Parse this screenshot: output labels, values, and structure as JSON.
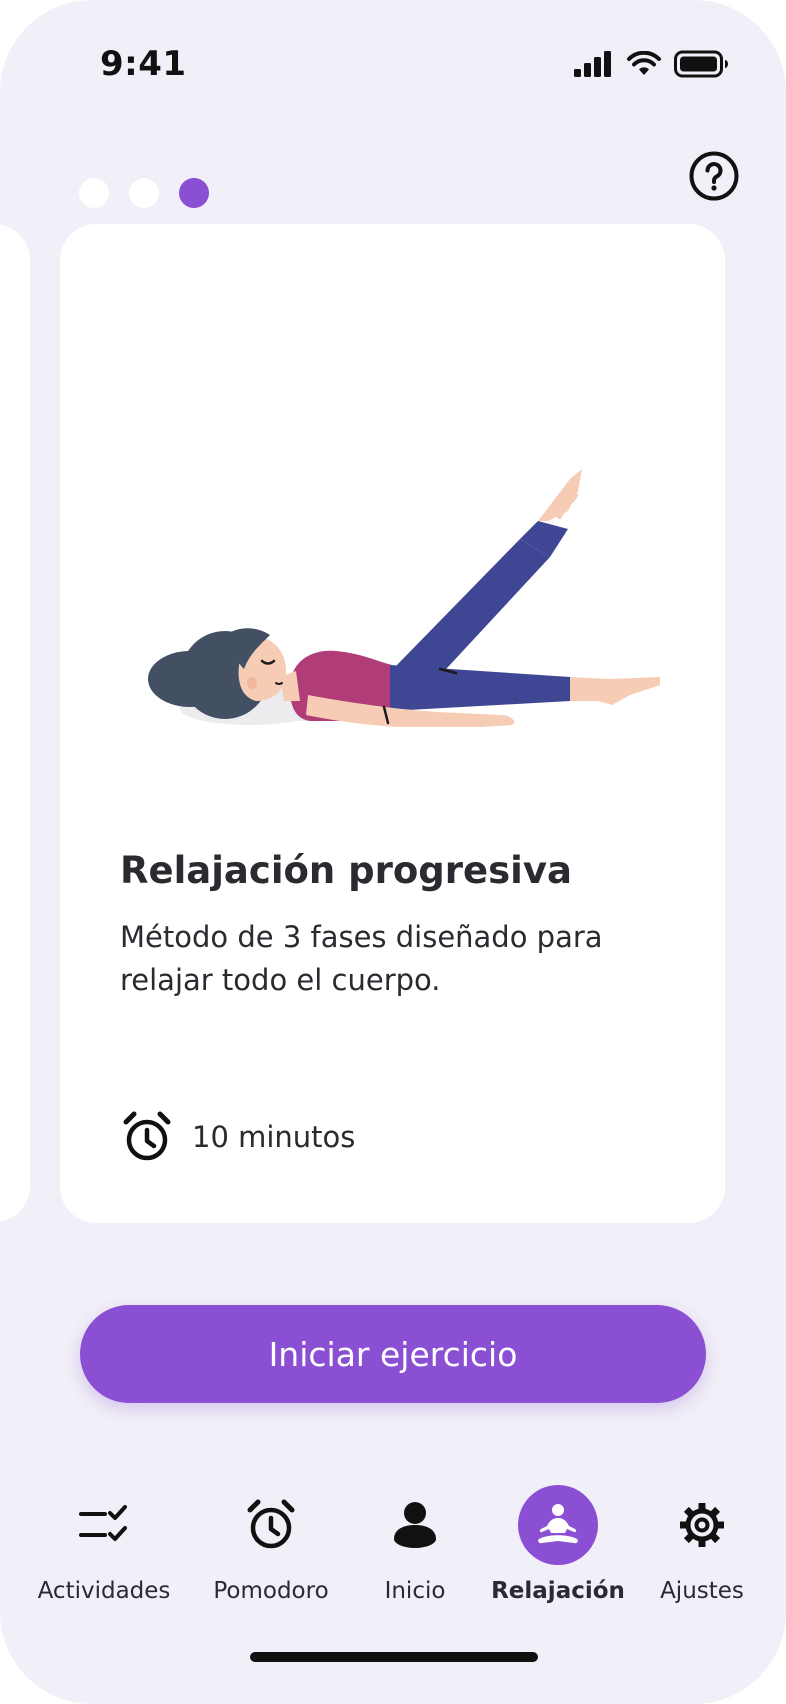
{
  "status_bar": {
    "time": "9:41"
  },
  "help": {
    "icon": "help-circle-icon"
  },
  "carousel": {
    "total": 3,
    "active_index": 2
  },
  "card": {
    "title": "Relajación progresiva",
    "description": "Método de 3 fases diseñado para relajar todo el cuerpo.",
    "duration": "10 minutos",
    "duration_icon": "alarm-clock-icon"
  },
  "start_button": {
    "label": "Iniciar ejercicio"
  },
  "nav": {
    "items": [
      {
        "label": "Actividades",
        "icon": "checklist-icon"
      },
      {
        "label": "Pomodoro",
        "icon": "alarm-clock-icon"
      },
      {
        "label": "Inicio",
        "icon": "user-icon"
      },
      {
        "label": "Relajación",
        "icon": "meditation-icon",
        "active": true
      },
      {
        "label": "Ajustes",
        "icon": "gear-icon"
      }
    ]
  },
  "colors": {
    "accent": "#8a4fd3",
    "background": "#f1eff7",
    "card": "#ffffff",
    "text": "#2a2a30"
  }
}
